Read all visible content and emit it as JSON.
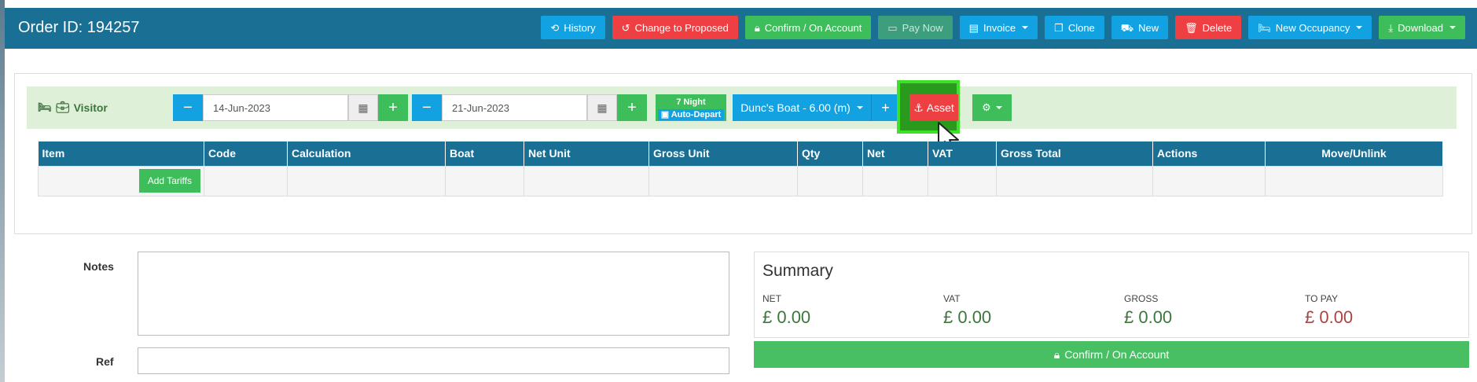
{
  "header": {
    "order_title": "Order ID: 194257",
    "buttons": [
      {
        "label": "History",
        "icon": "history-icon",
        "color": "#12a2e2"
      },
      {
        "label": "Change to Proposed",
        "icon": "undo-icon",
        "color": "#ee3f42"
      },
      {
        "label": "Confirm / On Account",
        "icon": "lock-icon",
        "color": "#3ebd5b"
      },
      {
        "label": "Pay Now",
        "icon": "money-icon",
        "color": "#3d9e7e"
      },
      {
        "label": "Invoice",
        "icon": "file-icon",
        "color": "#12a2e2"
      },
      {
        "label": "Clone",
        "icon": "copy-icon",
        "color": "#12a2e2"
      },
      {
        "label": "New",
        "icon": "basket-icon",
        "color": "#12a2e2"
      },
      {
        "label": "Delete",
        "icon": "trash-icon",
        "color": "#ee3f42"
      },
      {
        "label": "New Occupancy",
        "icon": "bed-icon",
        "color": "#12a2e2"
      },
      {
        "label": "Download",
        "icon": "download-icon",
        "color": "#3ebd5b"
      }
    ]
  },
  "occupancy": {
    "visitor_label": "Visitor",
    "start_date": "14-Jun-2023",
    "end_date": "21-Jun-2023",
    "nights_label": "7 Night",
    "auto_depart_label": "Auto-Depart",
    "boat_label": "Dunc's Boat - 6.00 (m)",
    "asset_label": "Asset"
  },
  "table": {
    "headers": [
      "Item",
      "Code",
      "Calculation",
      "Boat",
      "Net Unit",
      "Gross Unit",
      "Qty",
      "Net",
      "VAT",
      "Gross Total",
      "Actions",
      "Move/Unlink"
    ],
    "add_tariffs_label": "Add Tariffs"
  },
  "form": {
    "notes_label": "Notes",
    "ref_label": "Ref"
  },
  "summary": {
    "title": "Summary",
    "net_label": "NET",
    "net_value": "£ 0.00",
    "vat_label": "VAT",
    "vat_value": "£ 0.00",
    "gross_label": "GROSS",
    "gross_value": "£ 0.00",
    "topay_label": "TO PAY",
    "topay_value": "£ 0.00",
    "confirm_label": "Confirm / On Account"
  }
}
